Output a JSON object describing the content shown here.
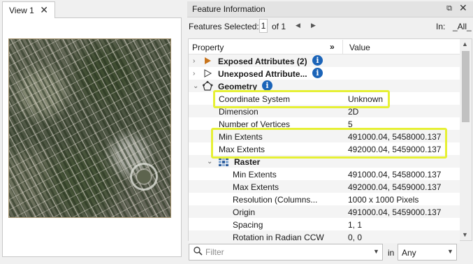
{
  "view": {
    "tab_label": "View 1",
    "close_glyph": "✕"
  },
  "panel": {
    "title": "Feature Information",
    "float_glyph": "⧉",
    "close_glyph": "✕"
  },
  "selection": {
    "label": "Features Selected:",
    "current": "1",
    "of_text": "of 1",
    "prev_glyph": "◀",
    "next_glyph": "▶",
    "in_label": "In:",
    "in_value": "_All_"
  },
  "table": {
    "columns": {
      "property": "Property",
      "expand": "»",
      "value": "Value"
    },
    "groups": {
      "exposed": "Exposed Attributes (2)",
      "unexposed": "Unexposed Attribute...",
      "geometry": "Geometry",
      "raster": "Raster"
    },
    "geometry_rows": [
      {
        "name": "Coordinate System",
        "value": "Unknown"
      },
      {
        "name": "Dimension",
        "value": "2D"
      },
      {
        "name": "Number of Vertices",
        "value": "5"
      },
      {
        "name": "Min Extents",
        "value": "491000.04, 5458000.137"
      },
      {
        "name": "Max Extents",
        "value": "492000.04, 5459000.137"
      }
    ],
    "raster_rows": [
      {
        "name": "Min Extents",
        "value": "491000.04, 5458000.137"
      },
      {
        "name": "Max Extents",
        "value": "492000.04, 5459000.137"
      },
      {
        "name": "Resolution (Columns...",
        "value": "1000 x 1000 Pixels"
      },
      {
        "name": "Origin",
        "value": "491000.04, 5459000.137"
      },
      {
        "name": "Spacing",
        "value": "1, 1"
      },
      {
        "name": "Rotation in Radian CCW",
        "value": "0, 0"
      }
    ]
  },
  "filter": {
    "placeholder": "Filter",
    "in_label": "in",
    "scope_value": "Any"
  },
  "colors": {
    "highlight": "#e6f035",
    "info_icon": "#1b64b8",
    "exposed_arrow": "#c8741c"
  }
}
